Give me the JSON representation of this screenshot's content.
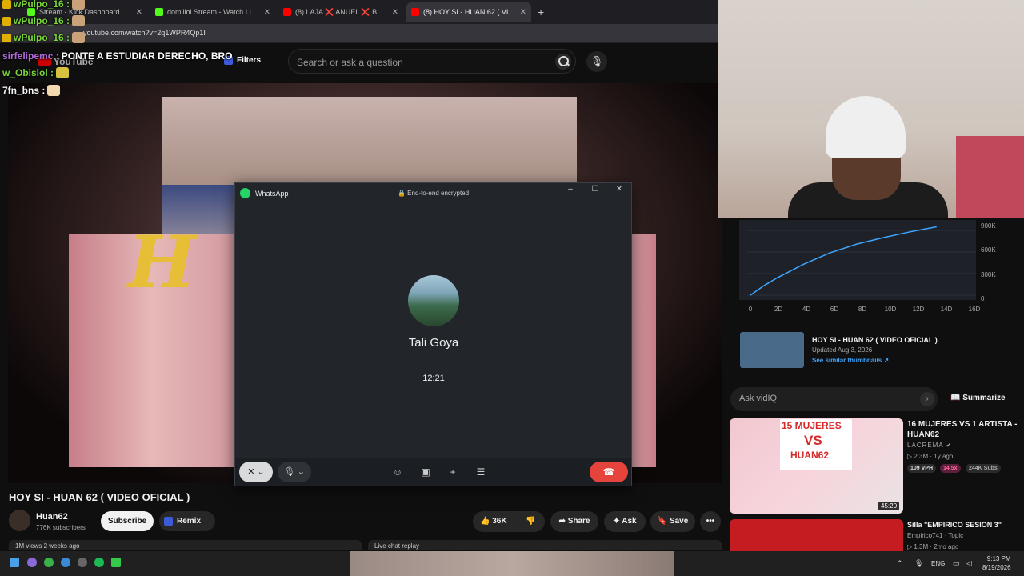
{
  "browser": {
    "tabs": [
      {
        "label": "Stream - Kick Dashboard",
        "color": "#53fc18"
      },
      {
        "label": "domiilol Stream - Watch Live o",
        "color": "#53fc18"
      },
      {
        "label": "(8) LAJA ❌ ANUEL ❌ BABYLO",
        "color": "#ff0000"
      },
      {
        "label": "(8) HOY SI - HUAN 62 ( VIDEO O",
        "color": "#ff0000",
        "active": true
      }
    ],
    "new_tab": "+",
    "url": "youtube.com/watch?v=2q1WPR4Qp1I"
  },
  "youtube_header": {
    "logo": "YouTube",
    "filters": "Filters",
    "search_placeholder": "Search or ask a question"
  },
  "chat": [
    {
      "user": "wPulpo_16 :",
      "message": ""
    },
    {
      "user": "wPulpo_16 :",
      "message": ""
    },
    {
      "user": "wPulpo_16 :",
      "message": ""
    },
    {
      "user": "sirfelipemc :",
      "message": "PONTE A ESTUDIAR DERECHO, BRO"
    },
    {
      "user": "w_Obislol :",
      "message": ""
    },
    {
      "user": "7fn_bns :",
      "message": ""
    }
  ],
  "whatsapp": {
    "app_name": "WhatsApp",
    "encryption": "🔒 End-to-end encrypted",
    "contact": "Tali Goya",
    "dots": "..............",
    "timer": "12:21"
  },
  "video": {
    "title": "HOY SI - HUAN 62 ( VIDEO OFICIAL )",
    "channel": "Huan62",
    "subscribers": "776K subscribers",
    "subscribe": "Subscribe",
    "remix": "Remix",
    "likes": "36K",
    "share": "Share",
    "ask": "Ask",
    "save": "Save",
    "more": "•••",
    "views_line": "1M views  2 weeks ago",
    "live_chat": "Live chat replay"
  },
  "vidiq_graph": {
    "y_labels": [
      "900K",
      "600K",
      "300K",
      "0"
    ],
    "x_labels": [
      "0",
      "2D",
      "4D",
      "6D",
      "8D",
      "10D",
      "12D",
      "14D",
      "16D"
    ],
    "curve": [
      [
        0,
        0
      ],
      [
        1,
        130000
      ],
      [
        2,
        240000
      ],
      [
        4,
        430000
      ],
      [
        6,
        590000
      ],
      [
        8,
        710000
      ],
      [
        10,
        800000
      ],
      [
        12,
        880000
      ],
      [
        14,
        950000
      ]
    ],
    "line_color": "#3ea6ff"
  },
  "thumb_card": {
    "title": "HOY SI - HUAN 62 ( VIDEO OFICIAL )",
    "updated": "Updated Aug 3, 2026",
    "link": "See similar thumbnails ↗"
  },
  "ask_vidiq": {
    "placeholder": "Ask vidIQ",
    "arrow": "›",
    "summarize": "Summarize"
  },
  "recommendations": [
    {
      "title": "16 MUJERES VS 1 ARTISTA - HUAN62",
      "channel": "LACREMA",
      "meta": "▷ 2.3M · 1y ago",
      "badges": [
        "109 VPH",
        "14.5x",
        "244K Subs"
      ],
      "duration": "45:20",
      "thumb_text": [
        "15 MUJERES",
        "VS",
        "HUAN62"
      ]
    },
    {
      "title": "Silla \"EMPIRICO SESION 3\"",
      "channel": "Empirico741 · Topic",
      "meta": "▷ 1.3M · 2mo ago"
    }
  ],
  "taskbar": {
    "language": "ENG",
    "time": "9:13 PM",
    "date": "8/19/2026"
  }
}
